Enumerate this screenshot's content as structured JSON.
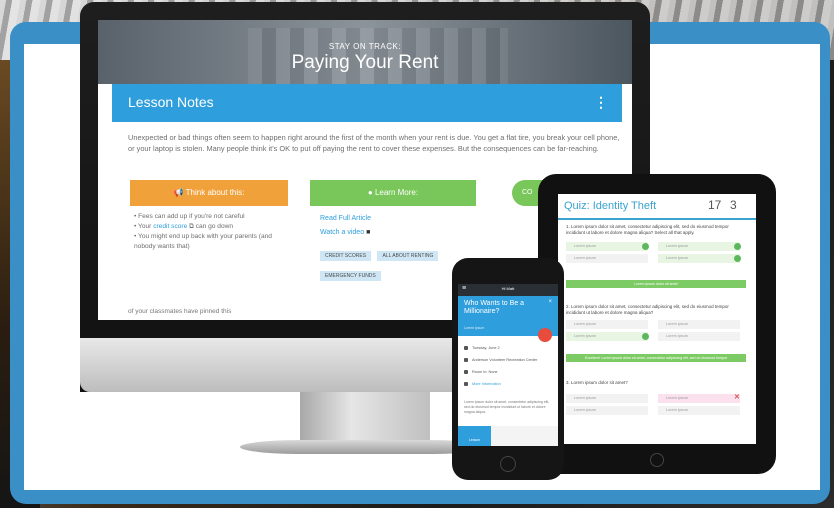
{
  "monitor": {
    "hero_eyebrow": "STAY ON TRACK:",
    "hero_title": "Paying Your Rent",
    "notes_title": "Lesson Notes",
    "notes_menu": "⋮",
    "paragraph": "Unexpected or bad things often seem to happen right around the first of the month when your rent is due. You get a flat tire, you break your cell phone, or your laptop is stolen. Many people think it's OK to put off paying the rent to cover these expenses. But the consequences can be far-reaching.",
    "think_button": "Think about this:",
    "learn_button": "Learn More:",
    "co_button": "CO",
    "bullets": [
      "Fees can add up if you're not careful",
      "Your credit score can go down",
      "You might end up back with your parents (and nobody wants that)"
    ],
    "bullet2_pre": "Your ",
    "bullet2_link": "credit score",
    "bullet2_post": " can go down",
    "link_read": "Read Full Article",
    "link_watch": "Watch a video",
    "tags": [
      "CREDIT SCORES",
      "ALL ABOUT RENTING",
      "EMERGENCY FUNDS"
    ],
    "classmates": "of your classmates have pinned this"
  },
  "tablet": {
    "quiz_title": "Quiz: Identity Theft",
    "stat1": "17",
    "stat2": "3",
    "q1": "1. Lorem ipsum dolor sit amet, consectetur adipiscing elit, sed do eiusmod tempor incididunt ut labore et dolore magna aliqua? Select all that apply.",
    "q2": "2. Lorem ipsum dolor sit amet, consectetur adipiscing elit, sed do eiusmod tempor incididunt ut labore et dolore magna aliqua?",
    "q3": "3. Lorem ipsum dolor sit amet?",
    "option": "Lorem ipsum",
    "bar1": "Lorem ipsum dolor sit amet",
    "bar2": "Excellent! Lorem ipsum dolor sit amet, consectetur adipiscing elit, sed do eiusmod tempor"
  },
  "phone": {
    "bar_title": "Hi Matt",
    "menu_icon": "≡",
    "card_title": "Who Wants to Be a Millionaire?",
    "card_sub": "Lorem ipsum",
    "close": "×",
    "items": [
      "Tuesday, June 2",
      "Anderson Volunteer Recreation Center",
      "Room In: None",
      "More Information"
    ],
    "body": "Lorem ipsum dolor sit amet, consectetur adipiscing elit, sed do eiusmod tempor incididunt ut labore et dolore magna aliqua.",
    "tab_active": "Lesson"
  },
  "colors": {
    "frame": "#3a8fc6",
    "accent_blue": "#2f9edc",
    "orange": "#f1a13a",
    "green": "#79c65a"
  }
}
